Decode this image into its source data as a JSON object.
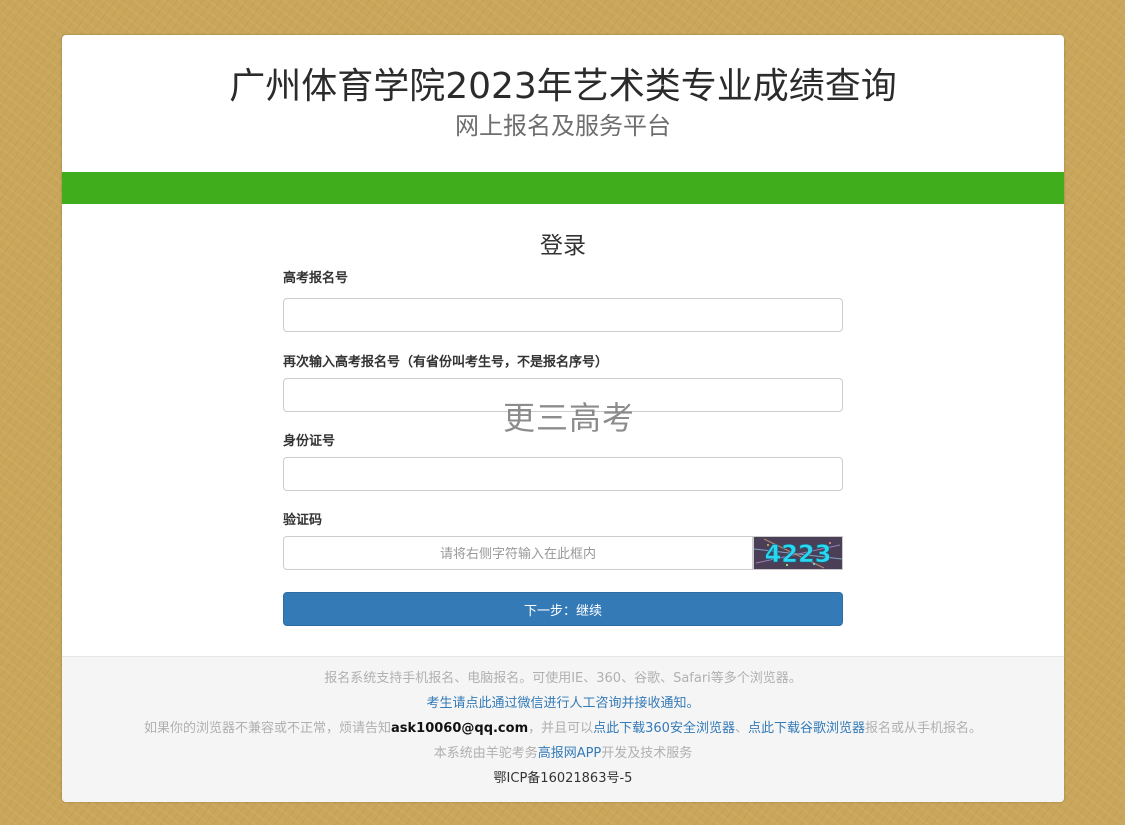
{
  "header": {
    "title": "广州体育学院2023年艺术类专业成绩查询",
    "subtitle": "网上报名及服务平台"
  },
  "form": {
    "title": "登录",
    "field1_label": "高考报名号",
    "field1_value": "",
    "field2_label": "再次输入高考报名号（有省份叫考生号，不是报名序号）",
    "field2_value": "",
    "field3_label": "身份证号",
    "field3_value": "",
    "captcha_label": "验证码",
    "captcha_placeholder": "请将右侧字符输入在此框内",
    "captcha_text": "4223",
    "submit_label": "下一步：继续"
  },
  "watermark": "更三高考",
  "footer": {
    "line1": "报名系统支持手机报名、电脑报名。可使用IE、360、谷歌、Safari等多个浏览器。",
    "line2_link": "考生请点此通过微信进行人工咨询并接收通知。",
    "line3_pre": "如果你的浏览器不兼容或不正常，烦请告知",
    "line3_email": "ask10060@qq.com",
    "line3_mid": "，并且可以",
    "line3_link1": "点此下载360安全浏览器",
    "line3_sep": "、",
    "line3_link2": "点此下载谷歌浏览器",
    "line3_post": "报名或从手机报名。",
    "line4_pre": "本系统由羊驼考务",
    "line4_link": "高报网APP",
    "line4_post": "开发及技术服务",
    "icp": "鄂ICP备16021863号-5"
  },
  "colors": {
    "accent_green": "#40ae1c",
    "primary_button": "#337ab7",
    "link": "#337ab7",
    "page_background": "#c9a65a"
  }
}
